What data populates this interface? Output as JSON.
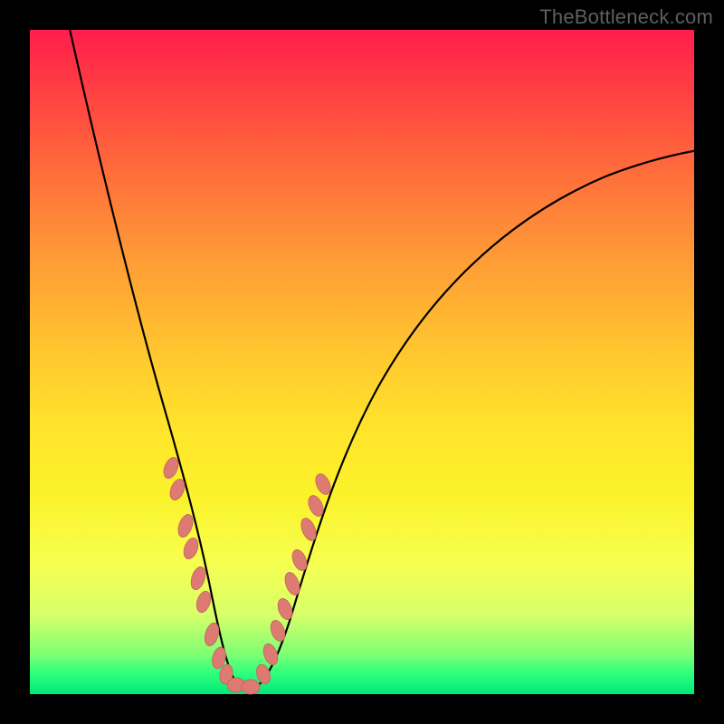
{
  "watermark": "TheBottleneck.com",
  "colors": {
    "gradient_top": "#ff1d4c",
    "gradient_bottom": "#00e879",
    "curve": "#000000",
    "markers": "#dd7b72",
    "marker_outline": "#c66a61"
  },
  "chart_data": {
    "type": "line",
    "title": "",
    "xlabel": "",
    "ylabel": "",
    "xlim": [
      0,
      100
    ],
    "ylim": [
      0,
      100
    ],
    "grid": false,
    "legend": false,
    "series": [
      {
        "name": "bottleneck-curve",
        "description": "V-shaped bottleneck curve; minimum (best match) near x≈30, y≈0",
        "points": [
          {
            "x": 5,
            "y": 100
          },
          {
            "x": 10,
            "y": 86
          },
          {
            "x": 14,
            "y": 70
          },
          {
            "x": 18,
            "y": 52
          },
          {
            "x": 20,
            "y": 40
          },
          {
            "x": 22,
            "y": 30
          },
          {
            "x": 24,
            "y": 20
          },
          {
            "x": 26,
            "y": 12
          },
          {
            "x": 28,
            "y": 5
          },
          {
            "x": 30,
            "y": 1
          },
          {
            "x": 32,
            "y": 1
          },
          {
            "x": 34,
            "y": 4
          },
          {
            "x": 36,
            "y": 10
          },
          {
            "x": 38,
            "y": 16
          },
          {
            "x": 40,
            "y": 22
          },
          {
            "x": 44,
            "y": 33
          },
          {
            "x": 50,
            "y": 45
          },
          {
            "x": 58,
            "y": 56
          },
          {
            "x": 66,
            "y": 63
          },
          {
            "x": 76,
            "y": 70
          },
          {
            "x": 88,
            "y": 75
          },
          {
            "x": 100,
            "y": 79
          }
        ]
      },
      {
        "name": "left-markers",
        "type": "scatter",
        "points": [
          {
            "x": 20.5,
            "y": 33
          },
          {
            "x": 21.5,
            "y": 30
          },
          {
            "x": 23.0,
            "y": 24
          },
          {
            "x": 23.8,
            "y": 21
          },
          {
            "x": 25.0,
            "y": 16
          },
          {
            "x": 25.8,
            "y": 13
          },
          {
            "x": 27.0,
            "y": 8
          },
          {
            "x": 28.2,
            "y": 5
          },
          {
            "x": 29.0,
            "y": 3
          },
          {
            "x": 30.5,
            "y": 1
          },
          {
            "x": 32.0,
            "y": 1
          }
        ]
      },
      {
        "name": "right-markers",
        "type": "scatter",
        "points": [
          {
            "x": 34.0,
            "y": 5
          },
          {
            "x": 35.0,
            "y": 8
          },
          {
            "x": 36.0,
            "y": 12
          },
          {
            "x": 37.0,
            "y": 15
          },
          {
            "x": 38.0,
            "y": 19
          },
          {
            "x": 39.0,
            "y": 22
          },
          {
            "x": 40.5,
            "y": 27
          },
          {
            "x": 41.5,
            "y": 30
          },
          {
            "x": 42.5,
            "y": 33
          }
        ]
      }
    ]
  }
}
